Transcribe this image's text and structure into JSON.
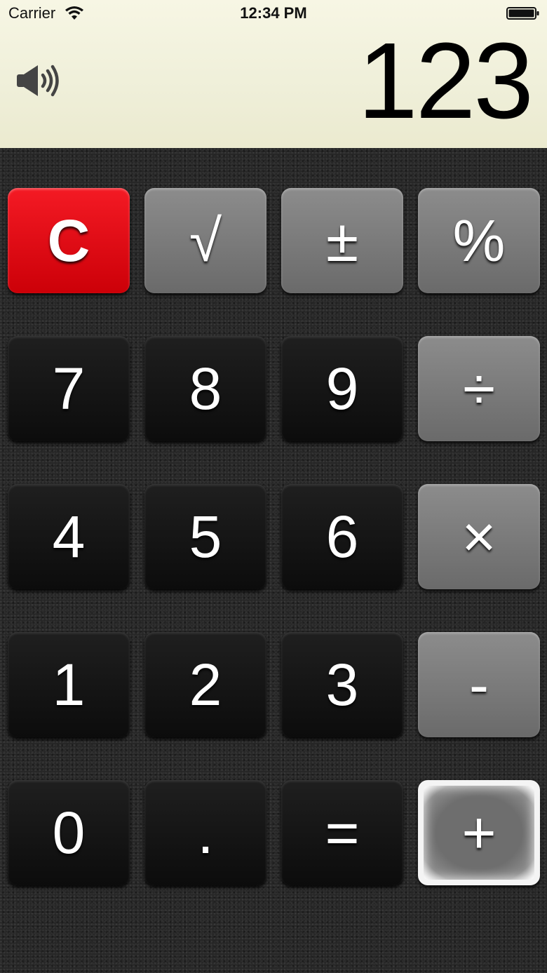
{
  "status_bar": {
    "carrier": "Carrier",
    "time": "12:34 PM"
  },
  "display": {
    "value": "123",
    "sound_icon": "speaker-volume-icon"
  },
  "keys": {
    "clear": "C",
    "sqrt": "√",
    "plus_minus": "±",
    "percent": "%",
    "seven": "7",
    "eight": "8",
    "nine": "9",
    "divide": "÷",
    "four": "4",
    "five": "5",
    "six": "6",
    "multiply": "×",
    "one": "1",
    "two": "2",
    "three": "3",
    "minus": "-",
    "zero": "0",
    "decimal": ".",
    "equals": "=",
    "plus": "+"
  },
  "colors": {
    "display_bg": "#efefd9",
    "clear_key": "#e3000f",
    "operator_key": "#7a7a7a",
    "digit_key": "#161616",
    "selected_key_border": "#f4f4f4"
  }
}
